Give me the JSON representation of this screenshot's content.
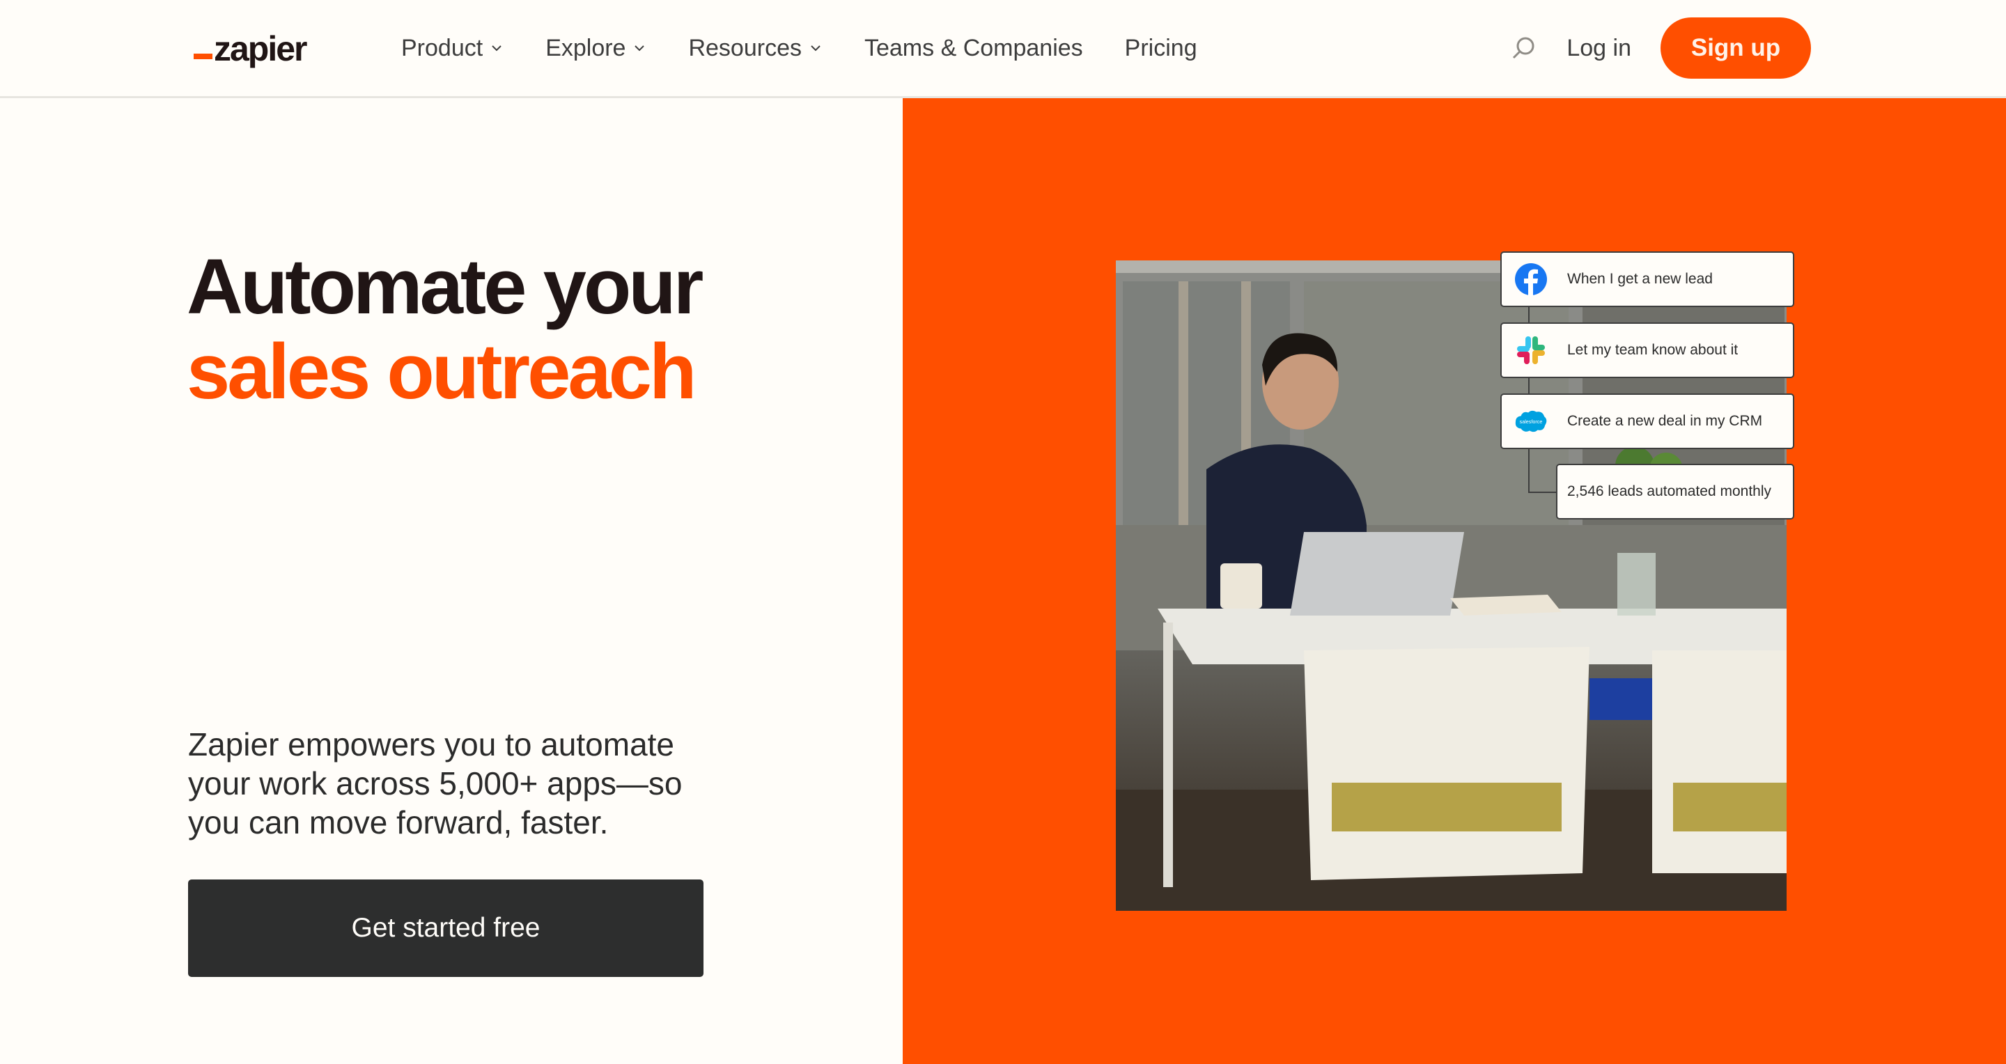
{
  "header": {
    "logo_text": "zapier",
    "nav": [
      {
        "label": "Product",
        "has_dropdown": true
      },
      {
        "label": "Explore",
        "has_dropdown": true
      },
      {
        "label": "Resources",
        "has_dropdown": true
      },
      {
        "label": "Teams & Companies",
        "has_dropdown": false
      },
      {
        "label": "Pricing",
        "has_dropdown": false
      }
    ],
    "search_icon": "search-icon",
    "login_label": "Log in",
    "signup_label": "Sign up"
  },
  "hero": {
    "headline_line1": "Automate your",
    "headline_line2": "sales outreach",
    "subcopy": "Zapier empowers you to automate your work across 5,000+ apps—so you can move forward, faster.",
    "cta_label": "Get started free"
  },
  "workflow": {
    "steps": [
      {
        "icon": "facebook-icon",
        "label": "When I get a new lead"
      },
      {
        "icon": "slack-icon",
        "label": "Let my team know about it"
      },
      {
        "icon": "salesforce-icon",
        "label": "Create a new deal in my CRM"
      }
    ],
    "result_label": "2,546 leads automated monthly",
    "salesforce_logo_text": "salesforce"
  },
  "colors": {
    "brand_orange": "#ff4f00",
    "page_background": "#fffdf9",
    "dark_button": "#2d2e2e",
    "headline_dark": "#201515"
  }
}
